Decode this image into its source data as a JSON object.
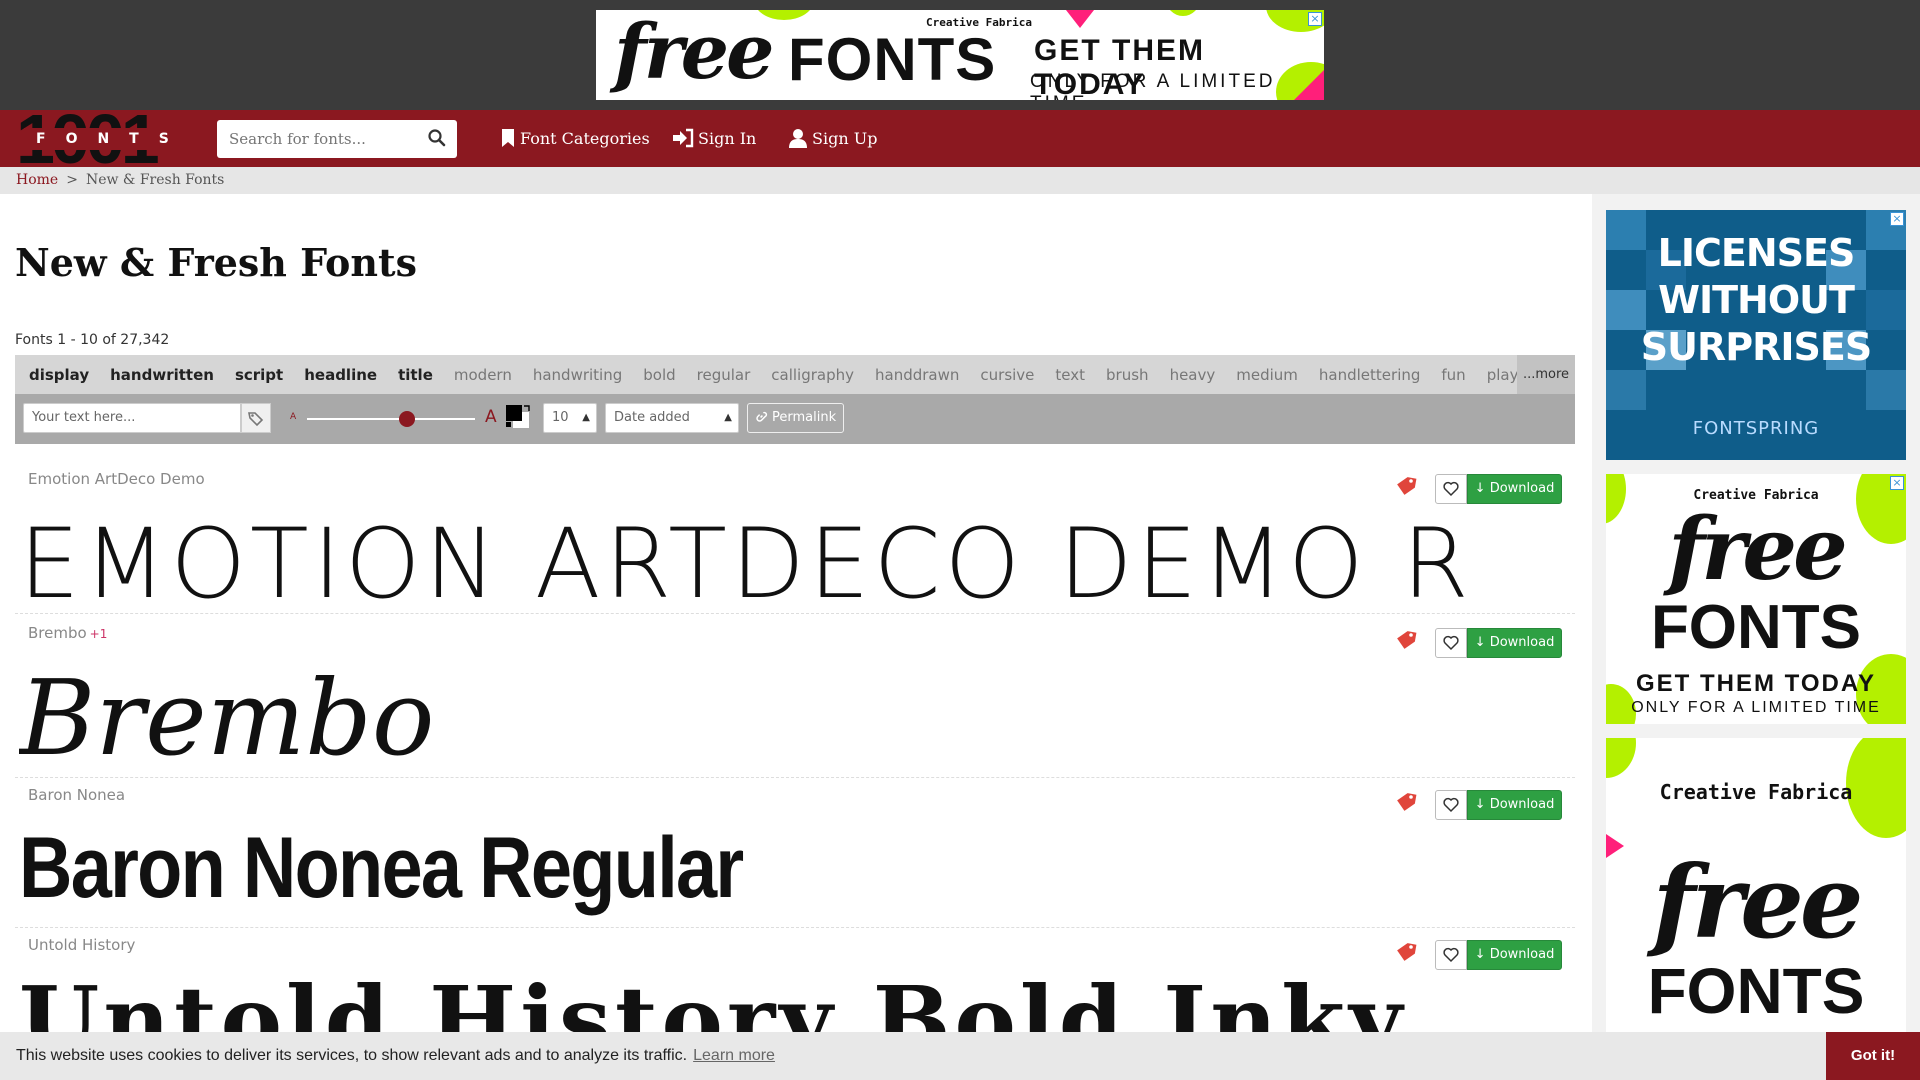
{
  "top_ad": {
    "free": "free",
    "fonts": "FONTS",
    "brand": "Creative Fabrica",
    "tagline": "GET THEM TODAY",
    "subline": "ONLY FOR A LIMITED TIME"
  },
  "nav": {
    "logo_digits": "1001",
    "logo_band": "FONTS",
    "search_placeholder": "Search for fonts...",
    "links": [
      {
        "label": "Font Categories",
        "icon": "bookmark-icon"
      },
      {
        "label": "Sign In",
        "icon": "sign-in-icon"
      },
      {
        "label": "Sign Up",
        "icon": "user-icon"
      }
    ]
  },
  "breadcrumb": {
    "home": "Home",
    "separator": ">",
    "current": "New & Fresh Fonts"
  },
  "main": {
    "title": "New & Fresh Fonts",
    "count": "Fonts 1 - 10 of 27,342",
    "tags": [
      {
        "label": "display",
        "strong": true
      },
      {
        "label": "handwritten",
        "strong": true
      },
      {
        "label": "script",
        "strong": true
      },
      {
        "label": "headline",
        "strong": true
      },
      {
        "label": "title",
        "strong": true
      },
      {
        "label": "modern",
        "strong": false
      },
      {
        "label": "handwriting",
        "strong": false
      },
      {
        "label": "bold",
        "strong": false
      },
      {
        "label": "regular",
        "strong": false
      },
      {
        "label": "calligraphy",
        "strong": false
      },
      {
        "label": "handdrawn",
        "strong": false
      },
      {
        "label": "cursive",
        "strong": false
      },
      {
        "label": "text",
        "strong": false
      },
      {
        "label": "brush",
        "strong": false
      },
      {
        "label": "heavy",
        "strong": false
      },
      {
        "label": "medium",
        "strong": false
      },
      {
        "label": "handlettering",
        "strong": false
      },
      {
        "label": "fun",
        "strong": false
      },
      {
        "label": "playful",
        "strong": false
      }
    ],
    "more": "...more",
    "toolbar": {
      "text_placeholder": "Your text here...",
      "small_a": "A",
      "big_a": "A",
      "size_value": "10",
      "sort_value": "Date added",
      "permalink": "Permalink"
    },
    "download_label": "Download",
    "fonts": [
      {
        "name": "Emotion ArtDeco Demo",
        "extra": "",
        "preview": "EMOTION ARTDECO DEMO R"
      },
      {
        "name": "Brembo",
        "extra": "+1",
        "preview": "Brembo"
      },
      {
        "name": "Baron Nonea",
        "extra": "",
        "preview": "Baron Nonea Regular"
      },
      {
        "name": "Untold History",
        "extra": "",
        "preview": "Untold History Bold Inky"
      }
    ]
  },
  "side_ads": {
    "licenses_lines": [
      "LICENSES",
      "WITHOUT",
      "SURPRISES"
    ],
    "licenses_brand": "FONTSPRING",
    "cf_brand": "Creative Fabrica",
    "cf_free": "free",
    "cf_fonts": "FONTS",
    "cf_tagline": "GET THEM TODAY",
    "cf_subline": "ONLY FOR A LIMITED TIME"
  },
  "cookie": {
    "message": "This website uses cookies to deliver its services, to show relevant ads and to analyze its traffic.",
    "learn_more": "Learn more",
    "accept": "Got it!"
  },
  "colors": {
    "brand_red": "#8b1820",
    "download_green": "#2ea043",
    "ad_lime": "#b4f000",
    "ad_pink": "#ff1f7a"
  }
}
